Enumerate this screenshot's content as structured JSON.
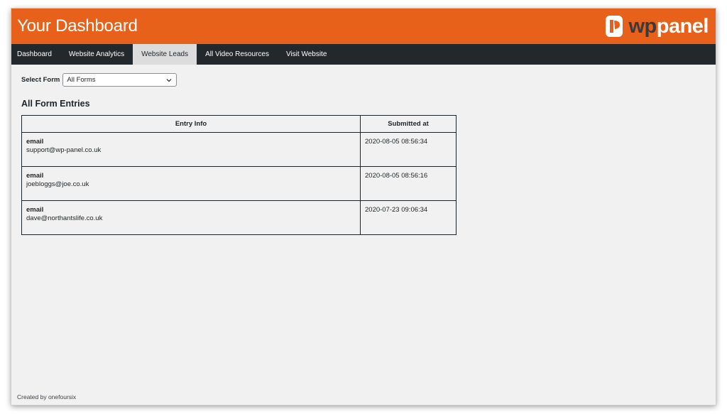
{
  "header": {
    "title": "Your Dashboard",
    "logo": {
      "wp": "wp",
      "panel": "panel",
      "icon": "wppanel-logo-icon"
    }
  },
  "colors": {
    "brand": "#e8611a",
    "nav_bg": "#23282d",
    "page_bg": "#f1f1f1",
    "active_tab_bg": "#dcdcdc"
  },
  "nav": {
    "items": [
      {
        "label": "Dashboard",
        "active": false
      },
      {
        "label": "Website Analytics",
        "active": false
      },
      {
        "label": "Website Leads",
        "active": true
      },
      {
        "label": "All Video Resources",
        "active": false
      },
      {
        "label": "Visit Website",
        "active": false
      }
    ]
  },
  "filter": {
    "label": "Select Form",
    "selected": "All Forms",
    "icon": "chevron-down-icon"
  },
  "entries": {
    "title": "All Form Entries",
    "columns": [
      "Entry Info",
      "Submitted at"
    ],
    "rows": [
      {
        "key": "email",
        "value": "support@wp-panel.co.uk",
        "submitted": "2020-08-05 08:56:34"
      },
      {
        "key": "email",
        "value": "joebloggs@joe.co.uk",
        "submitted": "2020-08-05 08:56:16"
      },
      {
        "key": "email",
        "value": "dave@northantslife.co.uk",
        "submitted": "2020-07-23 09:06:34"
      }
    ]
  },
  "footer": {
    "text": "Created by onefoursix"
  }
}
